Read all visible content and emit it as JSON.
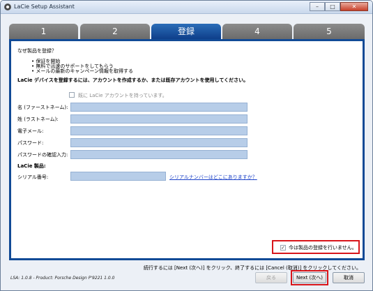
{
  "window": {
    "title": "LaCie Setup Assistant"
  },
  "tabs": [
    "1",
    "2",
    "登録",
    "4",
    "5"
  ],
  "intro": {
    "question": "なぜ製品を登録？",
    "bullets": [
      "保証を開始",
      "無料で迅速のサポートをしてもらう",
      "メールの最新のキャンペーン情報を取得する"
    ],
    "instruction": "LaCie デバイスを登録するには、アカウントを作成するか、または既存アカウントを使用してください。"
  },
  "account": {
    "existing_label": "既に LaCie アカウントを持っています。",
    "existing_checked": false
  },
  "form": {
    "first_name_label": "名 (ファーストネーム):",
    "last_name_label": "姓 (ラストネーム):",
    "email_label": "電子メール:",
    "password_label": "パスワード:",
    "password_confirm_label": "パスワードの確認入力:",
    "product_heading": "LaCie 製品:",
    "serial_label": "シリアル番号:",
    "serial_link": "シリアルナンバーはどこにありますか？"
  },
  "skip": {
    "label": "今は製品の登録を行いません。",
    "checked": true
  },
  "footer": {
    "instruction": "続行するには [Next (次へ)] をクリック、終了するには [Cancel (取消)] をクリックしてください。",
    "version": "LSA: 1.0.8 - Product: Porsche Design P'9221 1.0.0",
    "back_label": "戻る",
    "next_label": "Next (次へ)",
    "cancel_label": "取消"
  }
}
